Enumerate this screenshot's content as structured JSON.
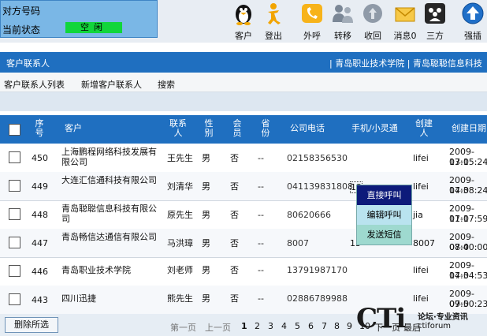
{
  "status": {
    "phone_label": "对方号码",
    "state_label": "当前状态",
    "state_value": "空闲",
    "state_color": "#11d63b"
  },
  "toolbar": [
    {
      "label": "客户",
      "icon": "penguin-icon"
    },
    {
      "label": "登出",
      "icon": "logout-person-icon"
    },
    {
      "label": "外呼",
      "icon": "phone-dial-icon"
    },
    {
      "label": "转移",
      "icon": "transfer-users-icon"
    },
    {
      "label": "收回",
      "icon": "retrieve-icon"
    },
    {
      "label": "消息0",
      "icon": "message-envelope-icon"
    },
    {
      "label": "三方",
      "icon": "conference-icon"
    },
    {
      "label": "强插",
      "icon": "up-arrow-icon"
    }
  ],
  "header": {
    "title": "客户联系人",
    "links": "| 青岛职业技术学院 | 青岛聪聪信息科技"
  },
  "menu": {
    "list": "客户联系人列表",
    "add": "新增客户联系人",
    "search": "搜索"
  },
  "table": {
    "headers": {
      "seq": "序号",
      "customer": "客户",
      "contact": "联系人",
      "gender": "性别",
      "member": "会员",
      "province": "省份",
      "phone": "公司电话",
      "mobile": "手机/小灵通",
      "creator": "创建人",
      "created": "创建日期"
    },
    "rows": [
      {
        "seq": "450",
        "customer": "上海鹏程网络科技发展有限公司",
        "contact": "王先生",
        "gender": "男",
        "member": "否",
        "province": "--",
        "phone": "02158356530",
        "mobile": "",
        "creator": "lifei",
        "date": "2009-07-0",
        "time": "13:15:24"
      },
      {
        "seq": "449",
        "customer": "大连汇信通科技有限公司",
        "contact": "刘清华",
        "gender": "男",
        "member": "否",
        "province": "--",
        "phone": "041139831808",
        "mobile": "13",
        "creator": "lifei",
        "date": "2009-07-0",
        "time": "14:38:24"
      },
      {
        "seq": "448",
        "customer": "青岛聪聪信息科技有限公司",
        "contact": "原先生",
        "gender": "男",
        "member": "否",
        "province": "--",
        "phone": "80620666",
        "mobile": "",
        "creator": "jia",
        "date": "2009-07-0",
        "time": "11:17:59"
      },
      {
        "seq": "447",
        "customer": "青岛畅信达通信有限公司",
        "contact": "马洪璋",
        "gender": "男",
        "member": "否",
        "province": "--",
        "phone": "8007",
        "mobile": "13",
        "creator": "8007",
        "date": "2009-07-0",
        "time": "08:40:00"
      },
      {
        "seq": "446",
        "customer": "青岛职业技术学院",
        "contact": "刘老师",
        "gender": "男",
        "member": "否",
        "province": "--",
        "phone": "13791987170",
        "mobile": "",
        "creator": "lifei",
        "date": "2009-07-0",
        "time": "14:34:53"
      },
      {
        "seq": "443",
        "customer": "四川迅捷",
        "contact": "熊先生",
        "gender": "男",
        "member": "否",
        "province": "--",
        "phone": "02886789988",
        "mobile": "",
        "creator": "lifei",
        "date": "2009-07-0",
        "time": "09:50:23"
      }
    ]
  },
  "popup": {
    "items": [
      "直接呼叫",
      "编辑呼叫",
      "发送短信"
    ]
  },
  "footer": {
    "delete": "删除所选",
    "first": "第一页",
    "prev": "上一页",
    "pages": [
      "1",
      "2",
      "3",
      "4",
      "5",
      "6",
      "7",
      "8",
      "9",
      "10"
    ],
    "next": "下一页",
    "last": "最后"
  },
  "watermark": {
    "main": "CTi",
    "sub1": "论坛·专业资讯",
    "sub2": "ctiforum"
  }
}
